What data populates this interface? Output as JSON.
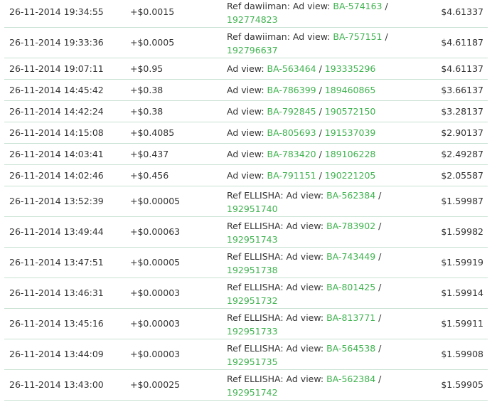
{
  "colors": {
    "link": "#3fb34f",
    "text": "#333333",
    "row_border": "#c9e2d3"
  },
  "rows": [
    {
      "date": "26-11-2014 19:34:55",
      "amount": "+$0.0015",
      "prefix": "Ref dawiiman: Ad view: ",
      "ad_id": "BA-574163",
      "sep": " / ",
      "view_id": "192774823",
      "balance": "$4.61337",
      "wrap": true
    },
    {
      "date": "26-11-2014 19:33:36",
      "amount": "+$0.0005",
      "prefix": "Ref dawiiman: Ad view: ",
      "ad_id": "BA-757151",
      "sep": " / ",
      "view_id": "192796637",
      "balance": "$4.61187",
      "wrap": true
    },
    {
      "date": "26-11-2014 19:07:11",
      "amount": "+$0.95",
      "prefix": "Ad view: ",
      "ad_id": "BA-563464",
      "sep": " / ",
      "view_id": "193335296",
      "balance": "$4.61137",
      "wrap": false
    },
    {
      "date": "26-11-2014 14:45:42",
      "amount": "+$0.38",
      "prefix": "Ad view: ",
      "ad_id": "BA-786399",
      "sep": " / ",
      "view_id": "189460865",
      "balance": "$3.66137",
      "wrap": false
    },
    {
      "date": "26-11-2014 14:42:24",
      "amount": "+$0.38",
      "prefix": "Ad view: ",
      "ad_id": "BA-792845",
      "sep": " / ",
      "view_id": "190572150",
      "balance": "$3.28137",
      "wrap": false
    },
    {
      "date": "26-11-2014 14:15:08",
      "amount": "+$0.4085",
      "prefix": "Ad view: ",
      "ad_id": "BA-805693",
      "sep": " / ",
      "view_id": "191537039",
      "balance": "$2.90137",
      "wrap": false
    },
    {
      "date": "26-11-2014 14:03:41",
      "amount": "+$0.437",
      "prefix": "Ad view: ",
      "ad_id": "BA-783420",
      "sep": " / ",
      "view_id": "189106228",
      "balance": "$2.49287",
      "wrap": false
    },
    {
      "date": "26-11-2014 14:02:46",
      "amount": "+$0.456",
      "prefix": "Ad view: ",
      "ad_id": "BA-791151",
      "sep": " / ",
      "view_id": "190221205",
      "balance": "$2.05587",
      "wrap": false
    },
    {
      "date": "26-11-2014 13:52:39",
      "amount": "+$0.00005",
      "prefix": "Ref ELLISHA: Ad view: ",
      "ad_id": "BA-562384",
      "sep": " / ",
      "view_id": "192951740",
      "balance": "$1.59987",
      "wrap": true
    },
    {
      "date": "26-11-2014 13:49:44",
      "amount": "+$0.00063",
      "prefix": "Ref ELLISHA: Ad view: ",
      "ad_id": "BA-783902",
      "sep": " / ",
      "view_id": "192951743",
      "balance": "$1.59982",
      "wrap": true
    },
    {
      "date": "26-11-2014 13:47:51",
      "amount": "+$0.00005",
      "prefix": "Ref ELLISHA: Ad view: ",
      "ad_id": "BA-743449",
      "sep": " / ",
      "view_id": "192951738",
      "balance": "$1.59919",
      "wrap": true
    },
    {
      "date": "26-11-2014 13:46:31",
      "amount": "+$0.00003",
      "prefix": "Ref ELLISHA: Ad view: ",
      "ad_id": "BA-801425",
      "sep": " / ",
      "view_id": "192951732",
      "balance": "$1.59914",
      "wrap": true
    },
    {
      "date": "26-11-2014 13:45:16",
      "amount": "+$0.00003",
      "prefix": "Ref ELLISHA: Ad view: ",
      "ad_id": "BA-813771",
      "sep": " / ",
      "view_id": "192951733",
      "balance": "$1.59911",
      "wrap": true
    },
    {
      "date": "26-11-2014 13:44:09",
      "amount": "+$0.00003",
      "prefix": "Ref ELLISHA: Ad view: ",
      "ad_id": "BA-564538",
      "sep": " / ",
      "view_id": "192951735",
      "balance": "$1.59908",
      "wrap": true
    },
    {
      "date": "26-11-2014 13:43:00",
      "amount": "+$0.00025",
      "prefix": "Ref ELLISHA: Ad view: ",
      "ad_id": "BA-562384",
      "sep": " / ",
      "view_id": "192951742",
      "balance": "$1.59905",
      "wrap": true
    }
  ]
}
